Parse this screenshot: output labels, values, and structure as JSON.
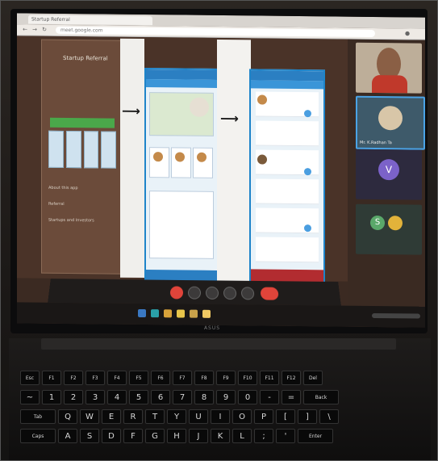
{
  "browser": {
    "tab_title": "Startup Referral",
    "url": "meet.google.com"
  },
  "slide": {
    "title": "Startup Referral",
    "lines": [
      "About this app",
      "Referral",
      "Startups and Investors"
    ]
  },
  "phone_screens": {
    "screen2_cards": 3,
    "screen3_messages": 6
  },
  "participants": [
    {
      "name": "",
      "color": "#c9b8a0"
    },
    {
      "name": "Mr. K.Radhan Ta",
      "color": "#3e5a6a"
    },
    {
      "name": "",
      "color": "#2d2a3e",
      "letter": "V"
    },
    {
      "name": "",
      "color": "#2f3b36",
      "letter": "S"
    }
  ],
  "meeting_controls": [
    "mic-icon",
    "camera-icon",
    "captions-icon",
    "present-icon",
    "more-icon",
    "end-call-icon"
  ],
  "keyboard": {
    "row1": [
      "Esc",
      "F1",
      "F2",
      "F3",
      "F4",
      "F5",
      "F6",
      "F7",
      "F8",
      "F9",
      "F10",
      "F11",
      "F12",
      "Del"
    ],
    "row2": [
      "~",
      "1",
      "2",
      "3",
      "4",
      "5",
      "6",
      "7",
      "8",
      "9",
      "0",
      "-",
      "=",
      "Back"
    ],
    "row3": [
      "Tab",
      "Q",
      "W",
      "E",
      "R",
      "T",
      "Y",
      "U",
      "I",
      "O",
      "P",
      "[",
      "]",
      "\\"
    ],
    "row4": [
      "Caps",
      "A",
      "S",
      "D",
      "F",
      "G",
      "H",
      "J",
      "K",
      "L",
      ";",
      "'",
      "Enter"
    ]
  },
  "colors": {
    "accent_blue": "#1e84c9",
    "end_call_red": "#e0443a",
    "green": "#4aa84a"
  }
}
